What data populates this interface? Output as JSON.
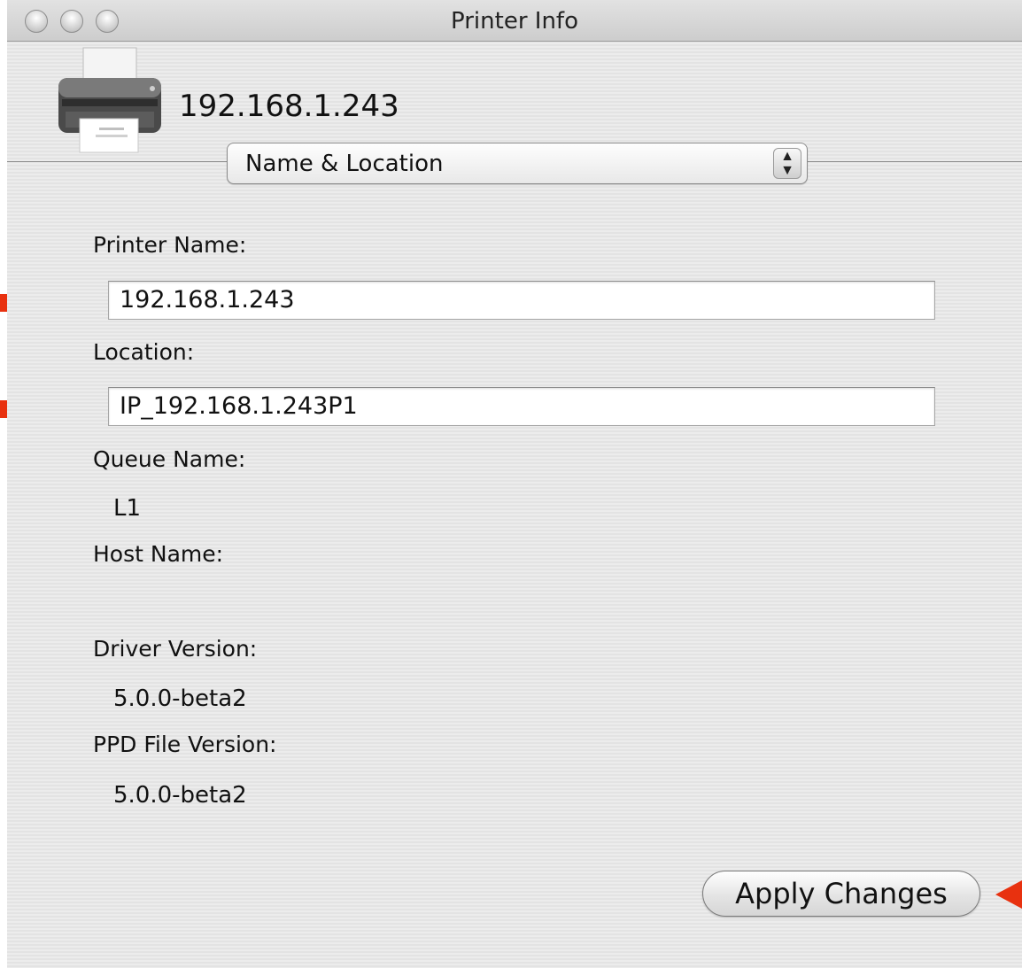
{
  "window": {
    "title": "Printer Info"
  },
  "device": {
    "name": "192.168.1.243",
    "icon": "printer-icon"
  },
  "panel_selector": {
    "selected": "Name & Location"
  },
  "fields": {
    "printer_name": {
      "label": "Printer Name:",
      "value": "192.168.1.243"
    },
    "location": {
      "label": "Location:",
      "value": "IP_192.168.1.243P1"
    }
  },
  "info": {
    "queue_name": {
      "label": "Queue Name:",
      "value": "L1"
    },
    "host_name": {
      "label": "Host Name:",
      "value": ""
    },
    "driver_version": {
      "label": "Driver Version:",
      "value": "5.0.0-beta2"
    },
    "ppd_file_version": {
      "label": "PPD File Version:",
      "value": "5.0.0-beta2"
    }
  },
  "actions": {
    "apply_label": "Apply Changes"
  },
  "colors": {
    "annotation_arrow": "#e8310f"
  }
}
